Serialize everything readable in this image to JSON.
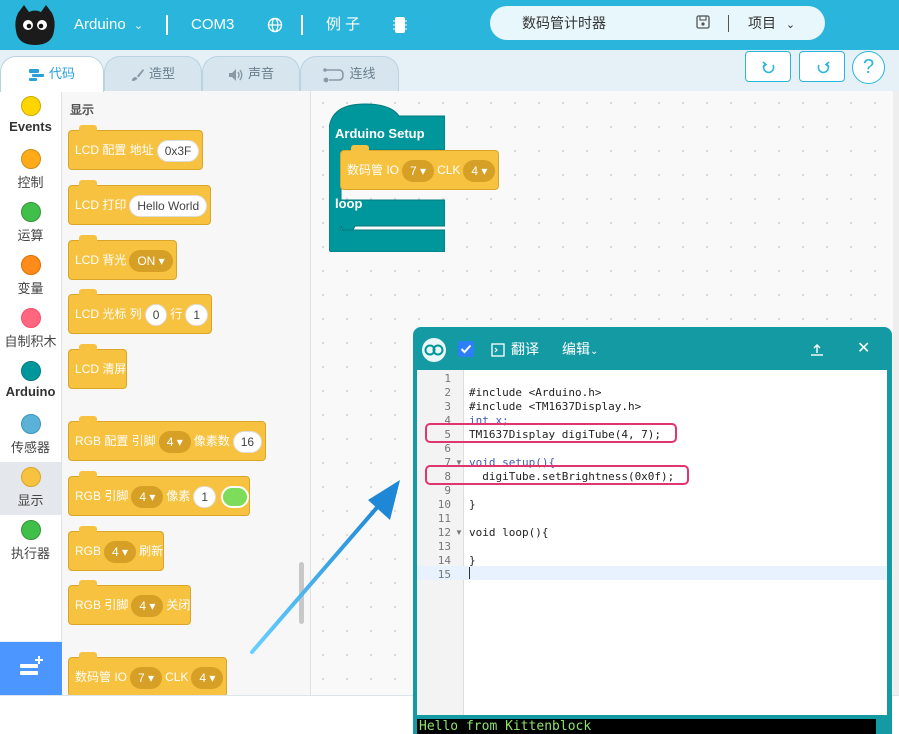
{
  "topbar": {
    "board": "Arduino",
    "port": "COM3",
    "examples": "例 子",
    "project_name": "数码管计时器",
    "project_menu": "项目"
  },
  "tabs": [
    {
      "label": "代码"
    },
    {
      "label": "造型"
    },
    {
      "label": "声音"
    },
    {
      "label": "连线"
    }
  ],
  "categories": [
    {
      "label": "Events",
      "color": "#ffd500"
    },
    {
      "label": "控制",
      "color": "#ffab19"
    },
    {
      "label": "运算",
      "color": "#40bf4a"
    },
    {
      "label": "变量",
      "color": "#ff8c1a"
    },
    {
      "label": "自制积木",
      "color": "#ff6680"
    },
    {
      "label": "Arduino",
      "color": "#00979c"
    },
    {
      "label": "传感器",
      "color": "#5cb1d6"
    },
    {
      "label": "显示",
      "color": "#f7c23f"
    },
    {
      "label": "执行器",
      "color": "#40bf4a"
    }
  ],
  "palette": {
    "title": "显示",
    "lcd_config": {
      "label": "LCD 配置 地址",
      "address": "0x3F"
    },
    "lcd_print": {
      "label": "LCD 打印",
      "text": "Hello World"
    },
    "lcd_backlight": {
      "label": "LCD 背光",
      "state": "ON"
    },
    "lcd_cursor": {
      "label1": "LCD 光标 列",
      "col": "0",
      "label2": "行",
      "row": "1"
    },
    "lcd_clear": {
      "label": "LCD 清屏"
    },
    "rgb_config": {
      "label1": "RGB 配置 引脚",
      "pin": "4",
      "label2": "像素数",
      "count": "16"
    },
    "rgb_pin": {
      "label1": "RGB 引脚",
      "pin": "4",
      "label2": "像素",
      "pixel": "1"
    },
    "rgb_refresh": {
      "label1": "RGB",
      "pin": "4",
      "label2": "刷新"
    },
    "rgb_off": {
      "label1": "RGB 引脚",
      "pin": "4",
      "label2": "关闭"
    },
    "tube": {
      "label1": "数码管 IO",
      "io": "7",
      "label2": "CLK",
      "clk": "4"
    }
  },
  "workspace": {
    "setup_label": "Arduino Setup",
    "tube_label1": "数码管 IO",
    "tube_io": "7",
    "tube_label2": "CLK",
    "tube_clk": "4",
    "loop_label": "loop"
  },
  "code_window": {
    "translate": "翻译",
    "edit": "编辑",
    "lines": [
      {
        "n": "1",
        "code": ""
      },
      {
        "n": "2",
        "code": "#include <Arduino.h>"
      },
      {
        "n": "3",
        "code": "#include <TM1637Display.h>"
      },
      {
        "n": "4",
        "code": "int x;"
      },
      {
        "n": "5",
        "code": "TM1637Display digiTube(4, 7);"
      },
      {
        "n": "6",
        "code": ""
      },
      {
        "n": "7",
        "code": "void setup(){"
      },
      {
        "n": "8",
        "code": "  digiTube.setBrightness(0x0f);"
      },
      {
        "n": "9",
        "code": ""
      },
      {
        "n": "10",
        "code": "}"
      },
      {
        "n": "11",
        "code": ""
      },
      {
        "n": "12",
        "code": "void loop(){"
      },
      {
        "n": "13",
        "code": ""
      },
      {
        "n": "14",
        "code": "}"
      },
      {
        "n": "15",
        "code": ""
      }
    ],
    "console": "Hello from Kittenblock"
  },
  "colors": {
    "topbar": "#2ab6dc",
    "arduino_block": "#00979c",
    "display_block": "#f7c23f",
    "highlight": "#e0356d",
    "arrow": "#2aa7e6"
  }
}
